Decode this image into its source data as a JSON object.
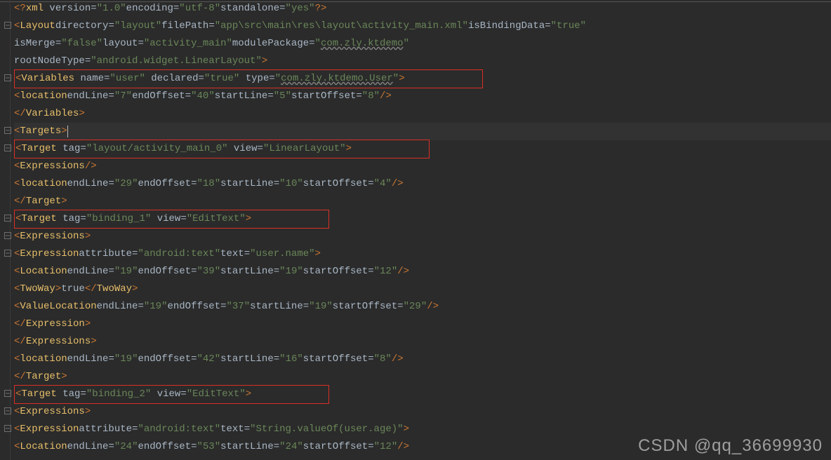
{
  "lines": {
    "l1": {
      "xml_decl": "<?xml version=\"1.0\" encoding=\"utf-8\" standalone=\"yes\"?>",
      "version": "1.0",
      "encoding": "utf-8",
      "standalone": "yes"
    },
    "l2": {
      "tag": "Layout",
      "a_dir": "directory",
      "v_dir": "layout",
      "a_fp": "filePath",
      "v_fp": "app\\src\\main\\res\\layout\\activity_main.xml",
      "a_bd": "isBindingData",
      "v_bd": "true"
    },
    "l3": {
      "a_im": "isMerge",
      "v_im": "false",
      "a_la": "layout",
      "v_la": "activity_main",
      "a_mp": "modulePackage",
      "v_mp": "com.zly.ktdemo"
    },
    "l4": {
      "a_rn": "rootNodeType",
      "v_rn": "android.widget.LinearLayout"
    },
    "l5": {
      "tag": "Variables",
      "a_nm": "name",
      "v_nm": "user",
      "a_dc": "declared",
      "v_dc": "true",
      "a_ty": "type",
      "v_ty": "com.zly.ktdemo.User"
    },
    "l6": {
      "tag": "location",
      "a_el": "endLine",
      "v_el": "7",
      "a_eo": "endOffset",
      "v_eo": "40",
      "a_sl": "startLine",
      "v_sl": "5",
      "a_so": "startOffset",
      "v_so": "8"
    },
    "l7": {
      "close": "Variables"
    },
    "l8": {
      "tag": "Targets"
    },
    "l9": {
      "tag": "Target",
      "a_tg": "tag",
      "v_tg": "layout/activity_main_0",
      "a_vw": "view",
      "v_vw": "LinearLayout"
    },
    "l10": {
      "tag": "Expressions"
    },
    "l11": {
      "tag": "location",
      "a_el": "endLine",
      "v_el": "29",
      "a_eo": "endOffset",
      "v_eo": "18",
      "a_sl": "startLine",
      "v_sl": "10",
      "a_so": "startOffset",
      "v_so": "4"
    },
    "l12": {
      "close": "Target"
    },
    "l13": {
      "tag": "Target",
      "a_tg": "tag",
      "v_tg": "binding_1",
      "a_vw": "view",
      "v_vw": "EditText"
    },
    "l14": {
      "tag": "Expressions"
    },
    "l15": {
      "tag": "Expression",
      "a_at": "attribute",
      "v_at": "android:text",
      "a_tx": "text",
      "v_tx": "user.name"
    },
    "l16": {
      "tag": "Location",
      "a_el": "endLine",
      "v_el": "19",
      "a_eo": "endOffset",
      "v_eo": "39",
      "a_sl": "startLine",
      "v_sl": "19",
      "a_so": "startOffset",
      "v_so": "12"
    },
    "l17": {
      "tag": "TwoWay",
      "txt": "true"
    },
    "l18": {
      "tag": "ValueLocation",
      "a_el": "endLine",
      "v_el": "19",
      "a_eo": "endOffset",
      "v_eo": "37",
      "a_sl": "startLine",
      "v_sl": "19",
      "a_so": "startOffset",
      "v_so": "29"
    },
    "l19": {
      "close": "Expression"
    },
    "l20": {
      "close": "Expressions"
    },
    "l21": {
      "tag": "location",
      "a_el": "endLine",
      "v_el": "19",
      "a_eo": "endOffset",
      "v_eo": "42",
      "a_sl": "startLine",
      "v_sl": "16",
      "a_so": "startOffset",
      "v_so": "8"
    },
    "l22": {
      "close": "Target"
    },
    "l23": {
      "tag": "Target",
      "a_tg": "tag",
      "v_tg": "binding_2",
      "a_vw": "view",
      "v_vw": "EditText"
    },
    "l24": {
      "tag": "Expressions"
    },
    "l25": {
      "tag": "Expression",
      "a_at": "attribute",
      "v_at": "android:text",
      "a_tx": "text",
      "v_tx": "String.valueOf(user.age)"
    },
    "l26": {
      "tag": "Location",
      "a_el": "endLine",
      "v_el": "24",
      "a_eo": "endOffset",
      "v_eo": "53",
      "a_sl": "startLine",
      "v_sl": "24",
      "a_so": "startOffset",
      "v_so": "12"
    }
  },
  "watermark": "CSDN @qq_36699930"
}
